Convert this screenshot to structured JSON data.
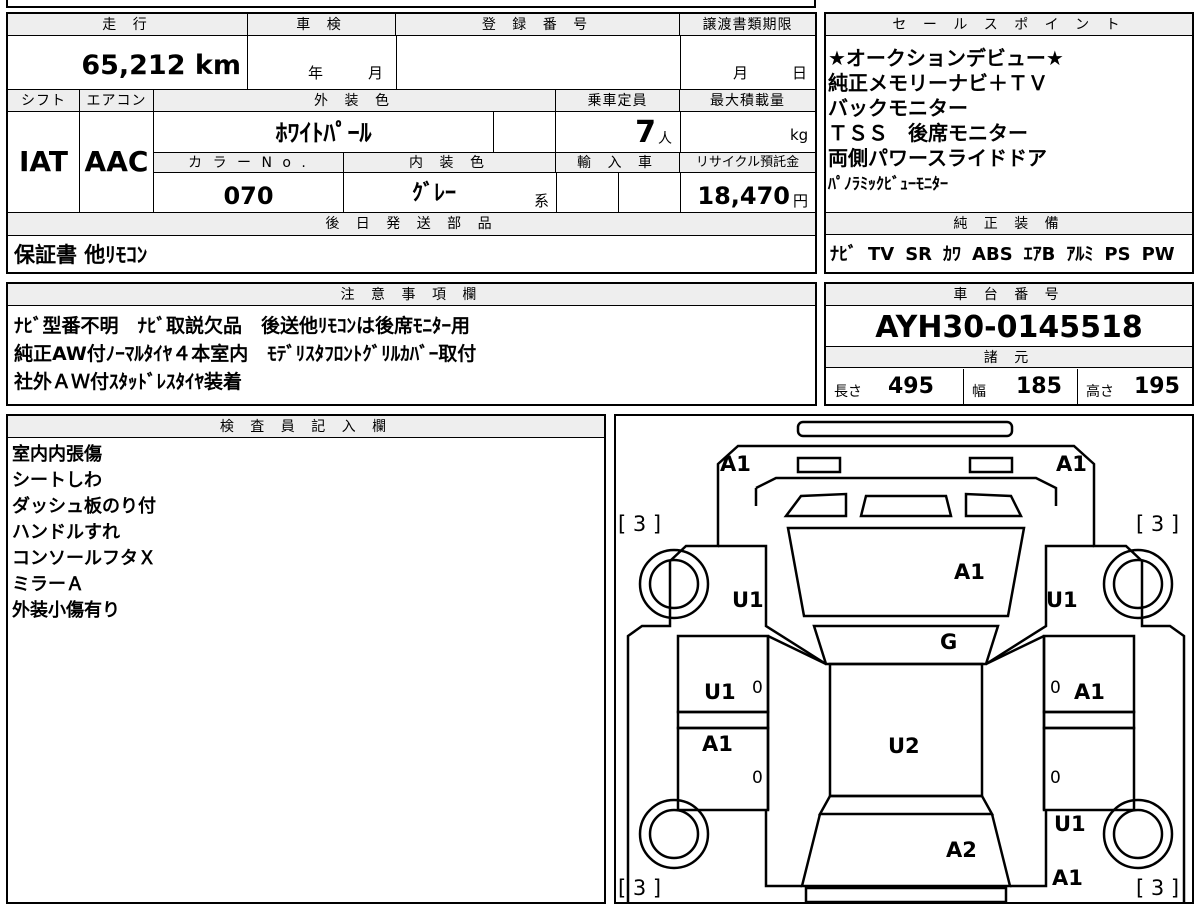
{
  "top": {
    "mileage_header": "走 行",
    "mileage": "65,212 km",
    "inspection_header": "車 検",
    "inspection_year": "年",
    "inspection_month": "月",
    "registration_header": "登 録 番 号",
    "transfer_header": "譲渡書類期限",
    "transfer_month": "月",
    "transfer_day": "日"
  },
  "row2": {
    "shift_header": "シフト",
    "aircon_header": "エアコン",
    "exterior_header": "外 装 色",
    "capacity_header": "乗車定員",
    "maxload_header": "最大積載量",
    "shift": "IAT",
    "aircon": "AAC",
    "exterior_color": "ﾎﾜｲﾄﾊﾟｰﾙ",
    "capacity": "7",
    "capacity_unit": "人",
    "maxload_unit": "kg",
    "color_no_header": "カ ラ ー N o .",
    "interior_header": "内 装 色",
    "import_header": "輸 入 車",
    "recycle_header": "リサイクル預託金",
    "color_no": "070",
    "interior_color": "ｸﾞﾚｰ",
    "interior_suffix": "系",
    "recycle_fee": "18,470",
    "recycle_unit": "円"
  },
  "later_parts": {
    "header": "後 日 発 送 部 品",
    "value": "保証書 他ﾘﾓｺﾝ"
  },
  "sales_points": {
    "header": "セ ー ル ス ポ イ ン ト",
    "lines": [
      "★オークションデビュー★",
      "純正メモリーナビ＋ＴＶ",
      "バックモニター",
      "ＴＳＳ　後席モニター",
      "両側パワースライドドア",
      "ﾊﾟﾉﾗﾐｯｸﾋﾞｭｰﾓﾆﾀｰ"
    ]
  },
  "equipment": {
    "header": "純 正 装 備",
    "items": [
      "ﾅﾋﾞ",
      "TV",
      "SR",
      "ｶﾜ",
      "ABS",
      "ｴｱB",
      "ｱﾙﾐ",
      "PS",
      "PW"
    ]
  },
  "notes": {
    "header": "注 意 事 項 欄",
    "lines": [
      "ﾅﾋﾞ型番不明　ﾅﾋﾞ取説欠品　後送他ﾘﾓｺﾝは後席ﾓﾆﾀｰ用",
      "純正AW付ﾉｰﾏﾙﾀｲﾔ４本室内　ﾓﾃﾞﾘｽﾀﾌﾛﾝﾄｸﾞﾘﾙｶﾊﾞｰ取付",
      "社外ＡＷ付ｽﾀｯﾄﾞﾚｽﾀｲﾔ装着"
    ]
  },
  "chassis": {
    "header": "車 台 番 号",
    "value": "AYH30-0145518"
  },
  "specs": {
    "header": "諸 元",
    "length_label": "長さ",
    "length": "495",
    "width_label": "幅",
    "width": "185",
    "height_label": "高さ",
    "height": "195"
  },
  "inspector": {
    "header": "検 査 員 記 入 欄",
    "lines": [
      "室内内張傷",
      "シートしわ",
      "ダッシュ板のり付",
      "ハンドルすれ",
      "コンソールフタＸ",
      "ミラーＡ",
      "外装小傷有り"
    ]
  },
  "diagram": {
    "marks": {
      "front_left": "A1",
      "front_right": "A1",
      "tire_fl": "[ 3 ]",
      "tire_fr": "[ 3 ]",
      "tire_rl": "[ 3 ]",
      "tire_rr": "[ 3 ]",
      "hood": "A1",
      "fender_l": "U1",
      "fender_r": "U1",
      "windshield": "G",
      "door_fl": "U1",
      "door_fr": "A1",
      "door_rl": "A1",
      "roof": "U2",
      "quarter_r": "U1",
      "rear": "A2",
      "rear_r": "A1",
      "zero_1": "0",
      "zero_2": "0",
      "zero_3": "0",
      "zero_4": "0"
    }
  }
}
